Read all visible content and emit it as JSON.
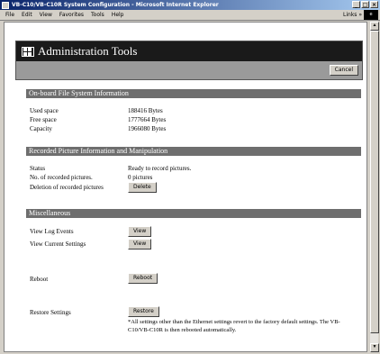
{
  "window": {
    "title": "VB-C10/VB-C10R System Configuration - Microsoft Internet Explorer",
    "controls": [
      "_",
      "□",
      "×"
    ]
  },
  "menu": {
    "items": [
      "File",
      "Edit",
      "View",
      "Favorites",
      "Tools",
      "Help"
    ],
    "links": "Links »"
  },
  "header": {
    "title": "Administration Tools",
    "cancel": "Cancel"
  },
  "filesystem": {
    "heading": "On-board File System Information",
    "rows": [
      {
        "label": "Used space",
        "value": "188416 Bytes"
      },
      {
        "label": "Free space",
        "value": "1777664 Bytes"
      },
      {
        "label": "Capacity",
        "value": "1966080 Bytes"
      }
    ]
  },
  "recorded": {
    "heading": "Recorded Picture Information and Manipulation",
    "status_label": "Status",
    "status_value": "Ready to record pictures.",
    "count_label": "No. of recorded pictures.",
    "count_value": "0 pictures",
    "delete_label": "Deletion of recorded pictures",
    "delete_button": "Delete"
  },
  "misc": {
    "heading": "Miscellaneous",
    "log_label": "View Log Events",
    "log_button": "View",
    "settings_label": "View Current Settings",
    "settings_button": "View",
    "reboot_label": "Reboot",
    "reboot_button": "Reboot",
    "restore_label": "Restore Settings",
    "restore_button": "Restore",
    "restore_note": "*All settings other than the Ethernet settings revert to the factory default settings. The VB-C10/VB-C10R is then rebooted automatically."
  }
}
